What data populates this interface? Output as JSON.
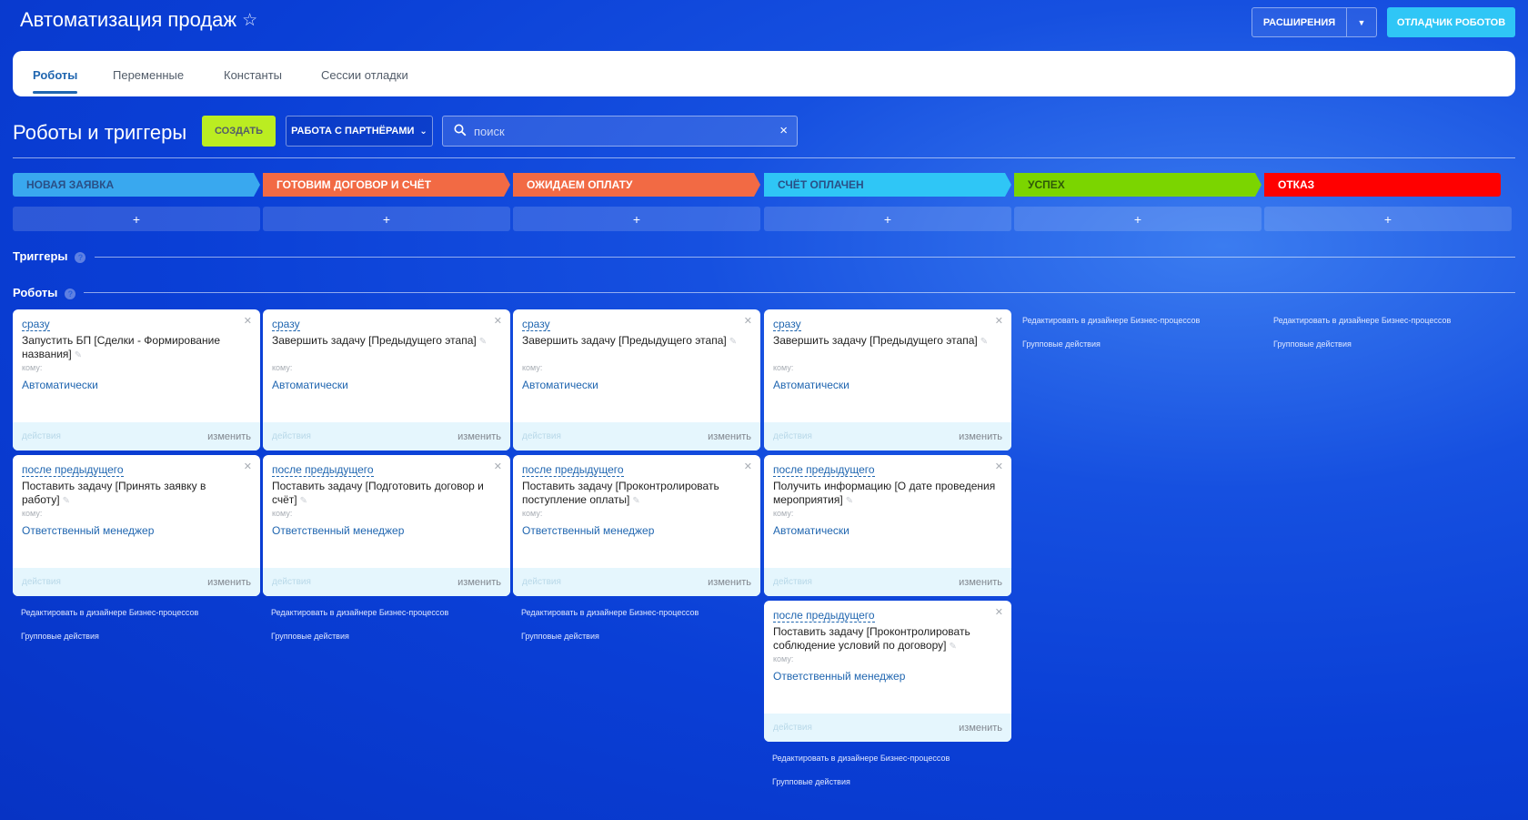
{
  "header": {
    "title": "Автоматизация продаж",
    "extensions_label": "РАСШИРЕНИЯ",
    "debugger_label": "ОТЛАДЧИК РОБОТОВ"
  },
  "tabs": [
    "Роботы",
    "Переменные",
    "Константы",
    "Сессии отладки"
  ],
  "toolbar": {
    "section_title": "Роботы и триггеры",
    "create_label": "СОЗДАТЬ",
    "filter_label": "РАБОТА С ПАРТНЁРАМИ",
    "search_placeholder": "поиск"
  },
  "stages": [
    {
      "name": "НОВАЯ ЗАЯВКА",
      "color": "#39a8ef"
    },
    {
      "name": "ГОТОВИМ ДОГОВОР И СЧЁТ",
      "color": "#f26a44"
    },
    {
      "name": "ОЖИДАЕМ ОПЛАТУ",
      "color": "#f26a44"
    },
    {
      "name": "СЧЁТ ОПЛАЧЕН",
      "color": "#2fc6f6"
    },
    {
      "name": "УСПЕХ",
      "color": "#7bd500"
    },
    {
      "name": "ОТКАЗ",
      "color": "#ff0000"
    }
  ],
  "add_symbol": "+",
  "labels": {
    "triggers": "Триггеры",
    "robots": "Роботы",
    "to": "кому:",
    "actions": "действия",
    "edit": "изменить",
    "edit_in_designer": "Редактировать в дизайнере Бизнес-процессов",
    "group_actions": "Групповые действия"
  },
  "robots": [
    {
      "when": "сразу",
      "title": "Запустить БП [Сделки - Формирование названия]",
      "assignee": "Автоматически"
    },
    {
      "when": "после предыдущего",
      "title": "Поставить задачу [Принять заявку в работу]",
      "assignee": "Ответственный менеджер"
    },
    {
      "when": "сразу",
      "title": "Завершить задачу [Предыдущего этапа]",
      "assignee": "Автоматически"
    },
    {
      "when": "после предыдущего",
      "title": "Поставить задачу [Подготовить договор и счёт]",
      "assignee": "Ответственный менеджер"
    },
    {
      "when": "сразу",
      "title": "Завершить задачу [Предыдущего этапа]",
      "assignee": "Автоматически"
    },
    {
      "when": "после предыдущего",
      "title": "Поставить задачу [Проконтролировать поступление оплаты]",
      "assignee": "Ответственный менеджер"
    },
    {
      "when": "сразу",
      "title": "Завершить задачу [Предыдущего этапа]",
      "assignee": "Автоматически"
    },
    {
      "when": "после предыдущего",
      "title": "Получить информацию [О дате проведения мероприятия]",
      "assignee": "Автоматически"
    },
    {
      "when": "после предыдущего",
      "title": "Поставить задачу [Проконтролировать соблюдение условий по договору]",
      "assignee": "Ответственный менеджер"
    }
  ]
}
